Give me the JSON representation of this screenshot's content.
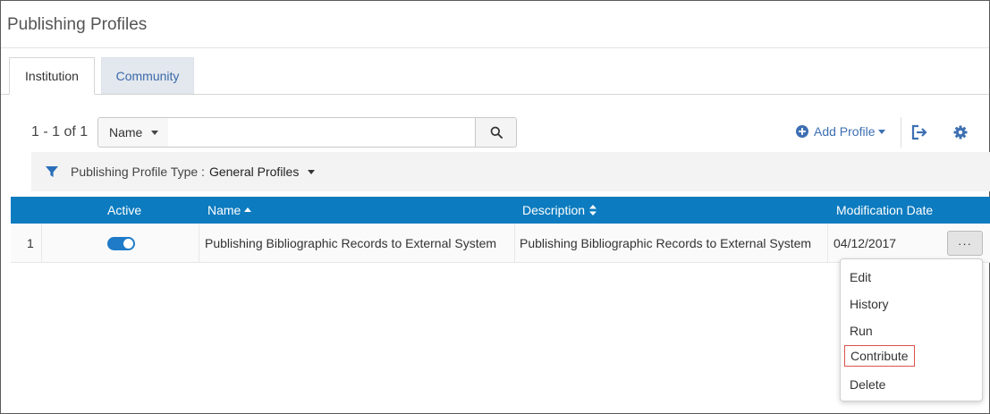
{
  "page": {
    "title": "Publishing Profiles"
  },
  "tabs": [
    {
      "label": "Institution",
      "active": true
    },
    {
      "label": "Community",
      "active": false
    }
  ],
  "toolbar": {
    "result_count": "1 - 1 of 1",
    "search_field": "Name",
    "search_value": "",
    "add_label": "Add Profile"
  },
  "filter": {
    "label": "Publishing Profile Type :",
    "value": "General Profiles"
  },
  "table": {
    "headers": {
      "active": "Active",
      "name": "Name",
      "description": "Description",
      "modification_date": "Modification Date"
    },
    "rows": [
      {
        "index": "1",
        "active": true,
        "name": "Publishing Bibliographic Records to External System",
        "description": "Publishing Bibliographic Records to External System",
        "modification_date": "04/12/2017"
      }
    ]
  },
  "row_menu": {
    "more_label": "···",
    "items": [
      "Edit",
      "History",
      "Run",
      "Contribute",
      "Delete"
    ],
    "highlighted_item": "Contribute"
  },
  "colors": {
    "header_blue": "#0c7bbf",
    "link_blue": "#3d6fb2",
    "highlight_red": "#d9534f"
  }
}
